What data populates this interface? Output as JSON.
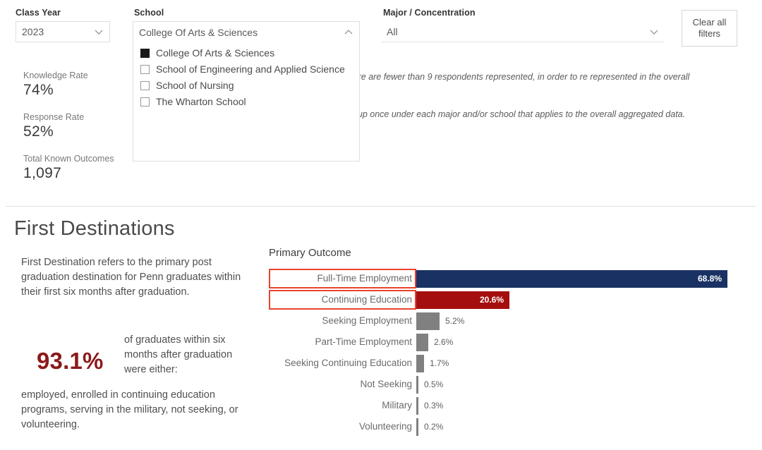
{
  "filters": {
    "class_year": {
      "label": "Class Year",
      "value": "2023",
      "icon": "chevron-down-icon"
    },
    "school": {
      "label": "School",
      "value": "College Of Arts & Sciences",
      "icon": "chevron-up-icon",
      "options": [
        {
          "label": "College Of Arts & Sciences",
          "checked": true
        },
        {
          "label": "School of Engineering and Applied Science",
          "checked": false
        },
        {
          "label": "School of Nursing",
          "checked": false
        },
        {
          "label": "The Wharton School",
          "checked": false
        }
      ]
    },
    "major": {
      "label": "Major / Concentration",
      "value": "All",
      "icon": "chevron-down-icon"
    },
    "clear_all": "Clear all\nfilters"
  },
  "kpis": [
    {
      "label": "Knowledge Rate",
      "value": "74%"
    },
    {
      "label": "Response Rate",
      "value": "52%"
    },
    {
      "label": "Total Known Outcomes",
      "value": "1,097"
    }
  ],
  "notes": [
    "s or cross selections where there are fewer than 9 respondents represented, in order to re represented in the overall aggregated outcome data.",
    "rom multiple schools will show up once under each major and/or school that applies to the overall aggregated data."
  ],
  "first_destinations": {
    "title": "First Destinations",
    "description": "First Destination refers to the primary post graduation destination for Penn graduates within their first six months after graduation.",
    "big_number": "93.1%",
    "middle_text": "of graduates within six months after graduation were either:",
    "bottom_text": "employed, enrolled in continuing education programs, serving in the military, not seeking, or volunteering."
  },
  "chart_data": {
    "type": "bar",
    "orientation": "horizontal",
    "title": "Primary Outcome",
    "xlabel": "",
    "ylabel": "",
    "xlim": [
      0,
      68.8
    ],
    "grid": false,
    "legend": false,
    "value_suffix": "%",
    "categories": [
      "Full-Time Employment",
      "Continuing Education",
      "Seeking Employment",
      "Part-Time Employment",
      "Seeking Continuing Education",
      "Not Seeking",
      "Military",
      "Volunteering"
    ],
    "values": [
      68.8,
      20.6,
      5.2,
      2.6,
      1.7,
      0.5,
      0.3,
      0.2
    ],
    "labels": [
      "68.8%",
      "20.6%",
      "5.2%",
      "2.6%",
      "1.7%",
      "0.5%",
      "0.3%",
      "0.2%"
    ],
    "colors": [
      "#1a3263",
      "#a50e0e",
      "#808080",
      "#808080",
      "#808080",
      "#808080",
      "#808080",
      "#808080"
    ],
    "highlighted": [
      "Full-Time Employment",
      "Continuing Education"
    ],
    "highlight_color": "#e8442e"
  }
}
